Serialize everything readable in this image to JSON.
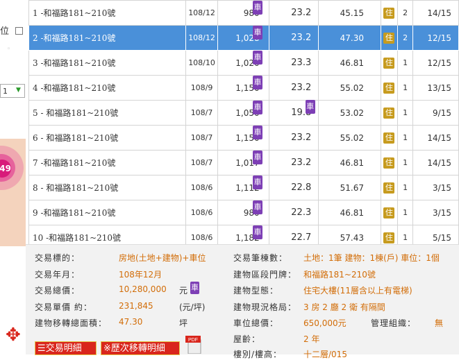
{
  "left_panel": {
    "partial_label": "位",
    "select_value": "1",
    "cluster_label": "49"
  },
  "rows": [
    {
      "no": "1",
      "addr": "-和福路181~210號",
      "date": "108/12",
      "price": "980",
      "area": "23.2",
      "unit": "45.15",
      "room": "2",
      "floor": "14/15",
      "area_icon": false,
      "selected": false
    },
    {
      "no": "2",
      "addr": "-和福路181~210號",
      "date": "108/12",
      "price": "1,028",
      "area": "23.2",
      "unit": "47.30",
      "room": "2",
      "floor": "12/15",
      "area_icon": false,
      "selected": true
    },
    {
      "no": "3",
      "addr": "-和福路181~210號",
      "date": "108/10",
      "price": "1,020",
      "area": "23.3",
      "unit": "46.81",
      "room": "1",
      "floor": "12/15",
      "area_icon": false,
      "selected": false
    },
    {
      "no": "4",
      "addr": "-和福路181~210號",
      "date": "108/9",
      "price": "1,150",
      "area": "23.2",
      "unit": "55.02",
      "room": "1",
      "floor": "13/15",
      "area_icon": false,
      "selected": false
    },
    {
      "no": "5",
      "addr": "- 和福路181~210號",
      "date": "108/7",
      "price": "1,050",
      "area": "19.8",
      "unit": "53.02",
      "room": "1",
      "floor": "9/15",
      "area_icon": true,
      "selected": false
    },
    {
      "no": "6",
      "addr": "- 和福路181~210號",
      "date": "108/7",
      "price": "1,150",
      "area": "23.2",
      "unit": "55.02",
      "room": "1",
      "floor": "14/15",
      "area_icon": false,
      "selected": false
    },
    {
      "no": "7",
      "addr": "-和福路181~210號",
      "date": "108/7",
      "price": "1,017",
      "area": "23.2",
      "unit": "46.81",
      "room": "1",
      "floor": "14/15",
      "area_icon": false,
      "selected": false
    },
    {
      "no": "8",
      "addr": "- 和福路181~210號",
      "date": "108/6",
      "price": "1,112",
      "area": "22.8",
      "unit": "51.67",
      "room": "1",
      "floor": "3/15",
      "area_icon": false,
      "selected": false
    },
    {
      "no": "9",
      "addr": "-和福路181~210號",
      "date": "108/6",
      "price": "980",
      "area": "22.3",
      "unit": "46.81",
      "room": "1",
      "floor": "3/15",
      "area_icon": false,
      "selected": false
    },
    {
      "no": "10",
      "addr": "-和福路181~210號",
      "date": "108/6",
      "price": "1,182",
      "area": "22.7",
      "unit": "57.43",
      "room": "1",
      "floor": "5/15",
      "area_icon": false,
      "selected": false
    }
  ],
  "icons": {
    "ru": "車",
    "ju": "住"
  },
  "detail": {
    "subject_label": "交易標的：",
    "subject_value": "房地(土地+建物)+車位",
    "ym_label": "交易年月：",
    "ym_value": "108年12月",
    "total_label": "交易總價：",
    "total_value": "10,280,000",
    "total_unit": "元",
    "unitprice_label": "交易單價 約：",
    "unitprice_value": "231,845",
    "unitprice_unit": "(元/坪)",
    "area_label": "建物移轉總面積：",
    "area_value": "47.30",
    "area_unit": "坪",
    "count_label": "交易筆棟數：",
    "count_value": "土地：1筆 建物：1棟(戶) 車位：1個",
    "addr_label": "建物區段門牌：",
    "addr_value": "和福路181~210號",
    "btype_label": "建物型態：",
    "btype_value": "住宅大樓(11層含以上有電梯)",
    "layout_label": "建物現況格局：",
    "layout_value": "3 房 2 廳 2 衛 有隔間",
    "parking_label": "車位總價：",
    "parking_value": "650,000元",
    "mgmt_label": "管理組織：",
    "mgmt_value": "無",
    "age_label": "屋齡：",
    "age_value": "2 年",
    "floor_label": "樓別/樓高：",
    "floor_value": "十二層/015"
  },
  "buttons": {
    "detail": "☰交易明細",
    "history": "※歷次移轉明細",
    "pdf": "PDF"
  },
  "colors": {
    "selected_row": "#4a90d9",
    "value_text": "#d26d08",
    "icon_ru": "#7d3fb5",
    "icon_ju": "#c79b1e",
    "button": "#d9261c"
  }
}
